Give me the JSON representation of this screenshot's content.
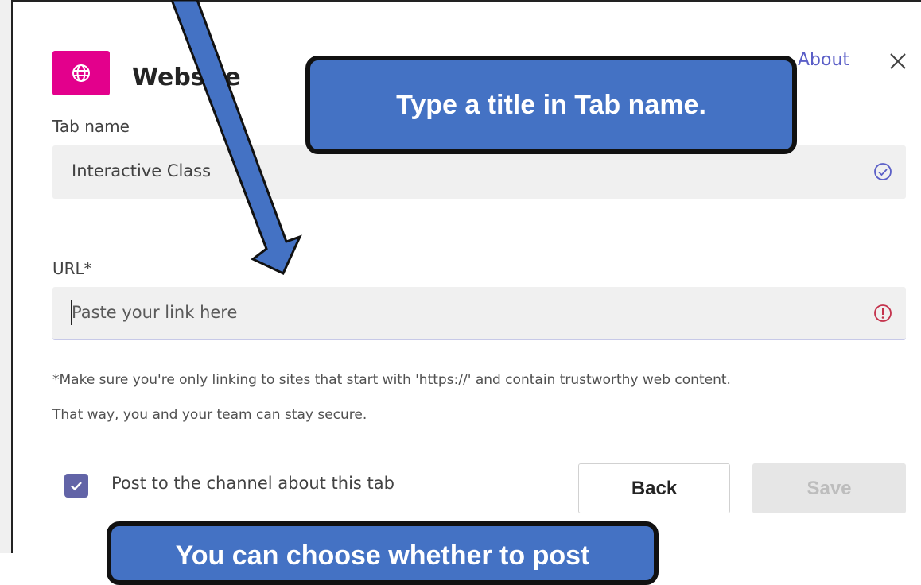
{
  "dialog": {
    "app_title": "Website",
    "about_label": "About",
    "close_icon": "close-icon",
    "app_icon": "globe-icon",
    "app_icon_color": "#e3008c"
  },
  "tab_name": {
    "label": "Tab name",
    "value": "Interactive Class",
    "status_icon": "check-circle-icon"
  },
  "url": {
    "label": "URL*",
    "placeholder": "Paste your link here",
    "status_icon": "error-circle-icon"
  },
  "helper": {
    "line1": "*Make sure you're only linking to sites that start with 'https://' and contain trustworthy web content.",
    "line2": "That way, you and your team can stay secure."
  },
  "post_option": {
    "label": "Post to the channel about this tab",
    "checked": true
  },
  "buttons": {
    "back_label": "Back",
    "save_label": "Save"
  },
  "callouts": {
    "top_text": "Type a title in Tab name.",
    "bottom_text": "You can choose whether to post",
    "fill_color": "#4472c4"
  },
  "colors": {
    "accent": "#5b5fc7",
    "error": "#c4314b"
  }
}
